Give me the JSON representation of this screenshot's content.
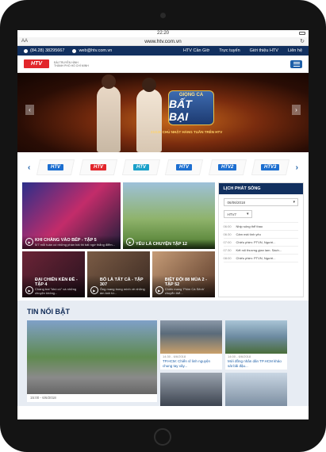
{
  "browser": {
    "time": "22:20",
    "url": "www.htv.com.vn",
    "aa_label": "AA"
  },
  "topbar": {
    "phone": "(84.28) 38295667",
    "email": "web@htv.com.vn",
    "links": [
      "HTV Cần Giờ",
      "Trực tuyến",
      "Giới thiệu HTV",
      "Liên hệ"
    ]
  },
  "header": {
    "logo_text": "HTV",
    "station_line1": "ĐÀI TRUYỀN HÌNH",
    "station_line2": "THÀNH PHỐ HỒ CHÍ MINH"
  },
  "banner": {
    "show_top": "GIỌNG CA",
    "show_main": "BẤT BẠI",
    "subtitle": "21G30 CHỦ NHẬT HÀNG TUẦN TRÊN HTV"
  },
  "channels": [
    "HTV",
    "HTV",
    "HTV",
    "HTV",
    "HTV2",
    "HTV3"
  ],
  "videos": [
    {
      "title": "KHI CHÀNG VÀO BẾP - TẬP 5",
      "desc": "5/7 mỗi tuần có những phần bài thi bất ngờ thắng điểm..."
    },
    {
      "title": "YÊU LÀ CHUYỆN TẬP 12",
      "desc": ""
    },
    {
      "title": "ĐẠI CHIẾN KÈN ĐỀ - TẬP 4",
      "desc": "Chàng trai \"khó có\" và những chuyện không..."
    },
    {
      "title": "BỐ LÀ TẤT CẢ - TẬP 307",
      "desc": "Ông mang trong mình về những ám ảnh từ..."
    },
    {
      "title": "BIỆT ĐỘI 88 MÙA 2 - TẬP 52",
      "desc": "Chiến mang 'Phim Cà Sênh' chuyển thể..."
    }
  ],
  "schedule": {
    "title": "LỊCH PHÁT SÓNG",
    "date": "06/06/2018",
    "channel": "HTV7",
    "items": [
      {
        "time": "06:00",
        "name": "Nhịp sống thể thao"
      },
      {
        "time": "06:30",
        "name": "Cảm mái tình yêu"
      },
      {
        "time": "07:00",
        "name": "Chiếu phim: PTVN, Người..."
      },
      {
        "time": "07:30",
        "name": "Kết nối thương gian lam. Sách..."
      },
      {
        "time": "08:00",
        "name": "Chiếu phim: PTVN, Người..."
      }
    ]
  },
  "featured": {
    "heading": "TIN NỔI BẬT",
    "main_meta": "15:00 - 6/6/2018",
    "cards": [
      {
        "meta": "14:30 - 6/6/2018",
        "title": "TP.HCM: Chiến sĩ linh nguyện chung tay xây..."
      },
      {
        "meta": "14:00 - 6/6/2018",
        "title": "Mới đồng nhân dân TP.HCM khảo sát bãi đậu..."
      },
      {
        "meta": "",
        "title": ""
      },
      {
        "meta": "",
        "title": ""
      }
    ]
  }
}
